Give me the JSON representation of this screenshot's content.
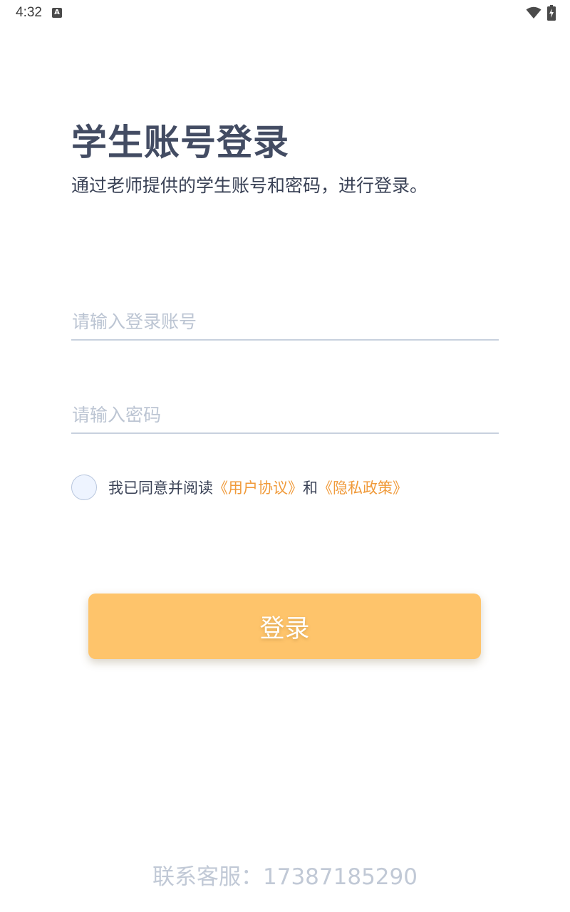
{
  "status_bar": {
    "time": "4:32",
    "notification_icon": "a-notification-icon",
    "wifi_icon": "wifi-icon",
    "battery_icon": "battery-charging-icon"
  },
  "header": {
    "title": "学生账号登录",
    "subtitle": "通过老师提供的学生账号和密码，进行登录。"
  },
  "form": {
    "account_placeholder": "请输入登录账号",
    "account_value": "",
    "password_placeholder": "请输入密码",
    "password_value": ""
  },
  "agreement": {
    "prefix": "我已同意并阅读",
    "user_agreement": "《用户协议》",
    "joiner": "和",
    "privacy_policy": "《隐私政策》",
    "checked": false
  },
  "login_button": {
    "label": "登录"
  },
  "footer": {
    "contact": "联系客服：17387185290"
  },
  "colors": {
    "title": "#434c63",
    "accent_link": "#f09a3a",
    "button_bg": "#fec46b",
    "placeholder": "#bcc5d3",
    "footer_text": "#c1c9d6"
  }
}
